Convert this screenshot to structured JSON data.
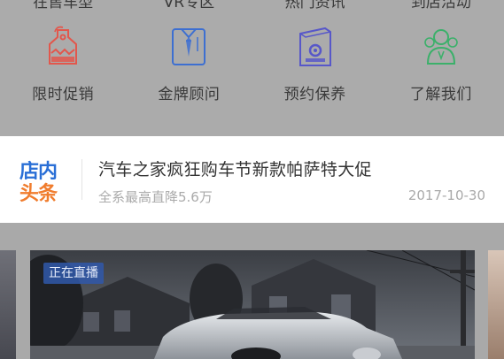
{
  "top_nav": {
    "labels": [
      "在售车型",
      "VR专区",
      "热门资讯",
      "到店活动"
    ]
  },
  "shortcuts": [
    {
      "label": "限时促销",
      "icon": "price-tag-icon",
      "color": "#e2574c"
    },
    {
      "label": "金牌顾问",
      "icon": "consultant-shirt-icon",
      "color": "#3d6fd1"
    },
    {
      "label": "预约保养",
      "icon": "maintenance-book-icon",
      "color": "#5757c9"
    },
    {
      "label": "了解我们",
      "icon": "team-people-icon",
      "color": "#3bb06a"
    }
  ],
  "news": {
    "logo_line1": "店内",
    "logo_line2": "头条",
    "title": "汽车之家疯狂购车节新款帕萨特大促",
    "subtitle": "全系最高直降5.6万",
    "date": "2017-10-30"
  },
  "banner": {
    "badge": "正在直播"
  }
}
